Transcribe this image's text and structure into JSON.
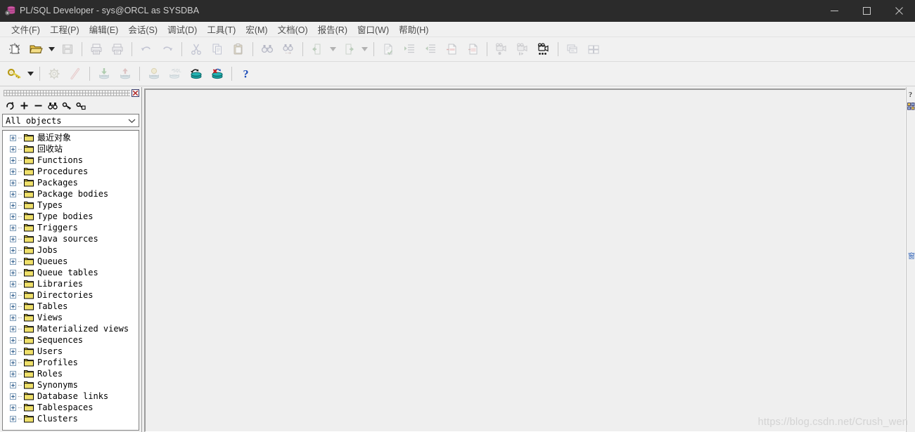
{
  "window": {
    "title": "PL/SQL Developer - sys@ORCL as SYSDBA",
    "app_icon": "database-gear-icon",
    "controls": {
      "minimize": "minimize-icon",
      "maximize": "maximize-icon",
      "close": "close-icon"
    },
    "titlebar_color": "#2b2b2b",
    "title_text_color": "#cfcfcf"
  },
  "menubar": {
    "items": [
      {
        "label": "文件(F)"
      },
      {
        "label": "工程(P)"
      },
      {
        "label": "编辑(E)"
      },
      {
        "label": "会话(S)"
      },
      {
        "label": "调试(D)"
      },
      {
        "label": "工具(T)"
      },
      {
        "label": "宏(M)"
      },
      {
        "label": "文档(O)"
      },
      {
        "label": "报告(R)"
      },
      {
        "label": "窗口(W)"
      },
      {
        "label": "帮助(H)"
      }
    ]
  },
  "toolbar_main": {
    "items": [
      {
        "icon": "new-document-icon",
        "enabled": true
      },
      {
        "icon": "open-folder-icon",
        "enabled": true
      },
      {
        "icon": "open-folder-dropdown-icon",
        "enabled": true,
        "dropdown": true
      },
      {
        "icon": "save-icon",
        "enabled": false
      },
      {
        "sep": true
      },
      {
        "icon": "print-icon",
        "enabled": false
      },
      {
        "icon": "print-preview-icon",
        "enabled": false
      },
      {
        "sep": true
      },
      {
        "icon": "undo-icon",
        "enabled": false
      },
      {
        "icon": "redo-icon",
        "enabled": false
      },
      {
        "sep": true
      },
      {
        "icon": "cut-icon",
        "enabled": false
      },
      {
        "icon": "copy-icon",
        "enabled": false
      },
      {
        "icon": "paste-icon",
        "enabled": false
      },
      {
        "sep": true
      },
      {
        "icon": "find-icon",
        "enabled": false
      },
      {
        "icon": "find-next-icon",
        "enabled": false
      },
      {
        "sep": true
      },
      {
        "icon": "navigate-back-icon",
        "enabled": false
      },
      {
        "icon": "navigate-back-dropdown-icon",
        "enabled": false,
        "dropdown": true
      },
      {
        "icon": "navigate-forward-icon",
        "enabled": false
      },
      {
        "icon": "navigate-forward-dropdown-icon",
        "enabled": false,
        "dropdown": true
      },
      {
        "sep": true
      },
      {
        "icon": "check-syntax-icon",
        "enabled": false
      },
      {
        "icon": "indent-icon",
        "enabled": false
      },
      {
        "icon": "outdent-icon",
        "enabled": false
      },
      {
        "icon": "comment-icon",
        "enabled": false
      },
      {
        "icon": "uncomment-icon",
        "enabled": false
      },
      {
        "sep": true
      },
      {
        "icon": "record-macro-icon",
        "enabled": false
      },
      {
        "icon": "pause-macro-icon",
        "enabled": false
      },
      {
        "icon": "play-macro-icon",
        "enabled": true
      },
      {
        "sep": true
      },
      {
        "icon": "cascade-windows-icon",
        "enabled": false
      },
      {
        "icon": "tile-windows-icon",
        "enabled": false
      }
    ]
  },
  "toolbar_session": {
    "items": [
      {
        "icon": "login-key-icon",
        "enabled": true
      },
      {
        "icon": "login-dropdown-icon",
        "enabled": true,
        "dropdown": true
      },
      {
        "sep": true
      },
      {
        "icon": "settings-gear-icon",
        "enabled": false
      },
      {
        "icon": "break-execution-icon",
        "enabled": false
      },
      {
        "sep": true
      },
      {
        "icon": "import-to-database-icon",
        "enabled": false
      },
      {
        "icon": "export-from-database-icon",
        "enabled": false
      },
      {
        "sep": true
      },
      {
        "icon": "commit-icon",
        "enabled": false
      },
      {
        "icon": "sql-database-icon",
        "enabled": false
      },
      {
        "icon": "execute-database-icon",
        "enabled": true
      },
      {
        "icon": "rollback-database-icon",
        "enabled": true
      },
      {
        "sep": true
      },
      {
        "icon": "help-question-icon",
        "enabled": true
      }
    ]
  },
  "browser": {
    "title_grip": "panel-drag-grip",
    "close_icon": "panel-close-icon",
    "tools": [
      {
        "icon": "refresh-icon"
      },
      {
        "icon": "expand-all-icon"
      },
      {
        "icon": "collapse-all-icon"
      },
      {
        "icon": "find-object-icon"
      },
      {
        "icon": "filter-icon"
      },
      {
        "icon": "object-options-icon"
      }
    ],
    "filter_combo": {
      "value": "All objects",
      "arrow_icon": "chevron-down-icon"
    },
    "tree_items": [
      {
        "label": "最近对象"
      },
      {
        "label": "回收站"
      },
      {
        "label": "Functions"
      },
      {
        "label": "Procedures"
      },
      {
        "label": "Packages"
      },
      {
        "label": "Package bodies"
      },
      {
        "label": "Types"
      },
      {
        "label": "Type bodies"
      },
      {
        "label": "Triggers"
      },
      {
        "label": "Java sources"
      },
      {
        "label": "Jobs"
      },
      {
        "label": "Queues"
      },
      {
        "label": "Queue tables"
      },
      {
        "label": "Libraries"
      },
      {
        "label": "Directories"
      },
      {
        "label": "Tables"
      },
      {
        "label": "Views"
      },
      {
        "label": "Materialized views"
      },
      {
        "label": "Sequences"
      },
      {
        "label": "Users"
      },
      {
        "label": "Profiles"
      },
      {
        "label": "Roles"
      },
      {
        "label": "Synonyms"
      },
      {
        "label": "Database links"
      },
      {
        "label": "Tablespaces"
      },
      {
        "label": "Clusters"
      }
    ]
  },
  "right_strip": {
    "tabs": [
      {
        "icon": "help-panel-icon"
      },
      {
        "icon": "templates-panel-icon"
      },
      {
        "icon": "window-list-panel-icon"
      }
    ]
  },
  "workarea": {
    "background": "#efefef"
  },
  "watermark": {
    "text": "https://blog.csdn.net/Crush_wen"
  }
}
